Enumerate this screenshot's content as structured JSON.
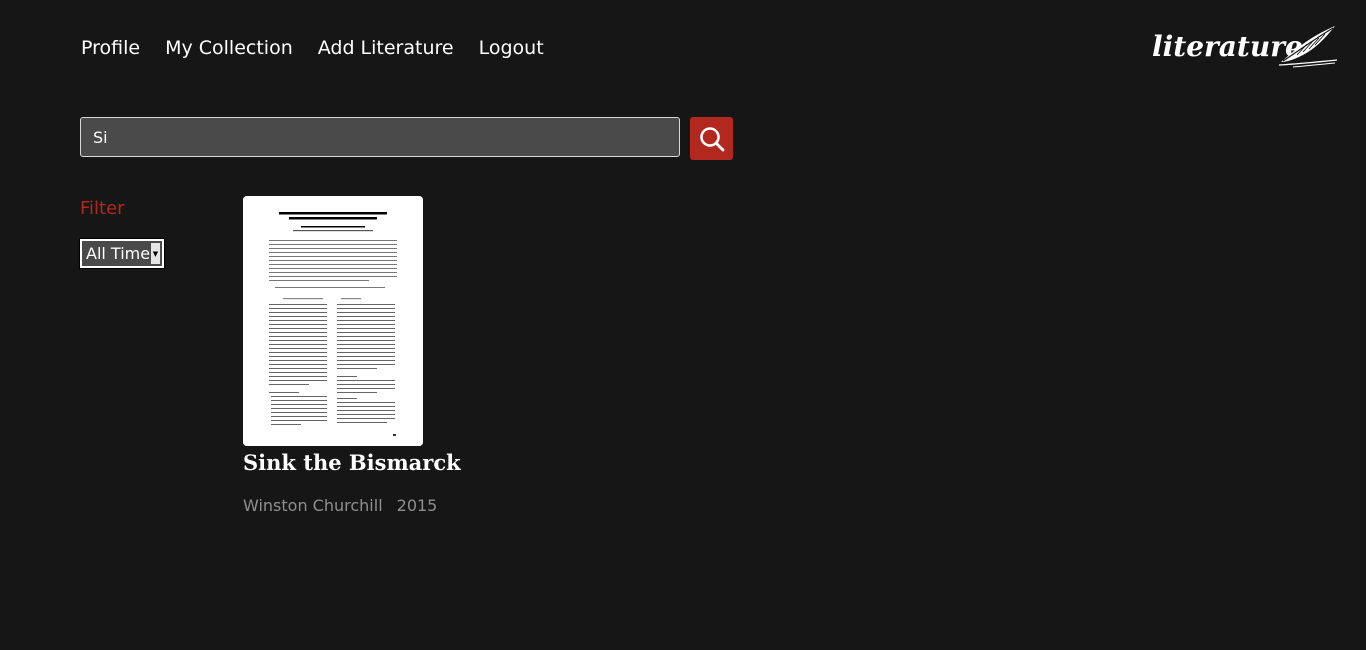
{
  "nav": {
    "items": [
      "Profile",
      "My Collection",
      "Add Literature",
      "Logout"
    ]
  },
  "logo": {
    "text": "literature",
    "icon": "feather-icon"
  },
  "search": {
    "value": "Si",
    "button_icon": "search-icon"
  },
  "filter": {
    "title": "Filter",
    "selected": "All Time"
  },
  "results": [
    {
      "title": "Sink the Bismarck",
      "author": "Winston Churchill",
      "year": "2015",
      "cover": "document-thumbnail"
    }
  ],
  "colors": {
    "background": "#161616",
    "accent": "#b3281e",
    "input_bg": "#4a4a4a",
    "muted_text": "#8f8f8f"
  }
}
